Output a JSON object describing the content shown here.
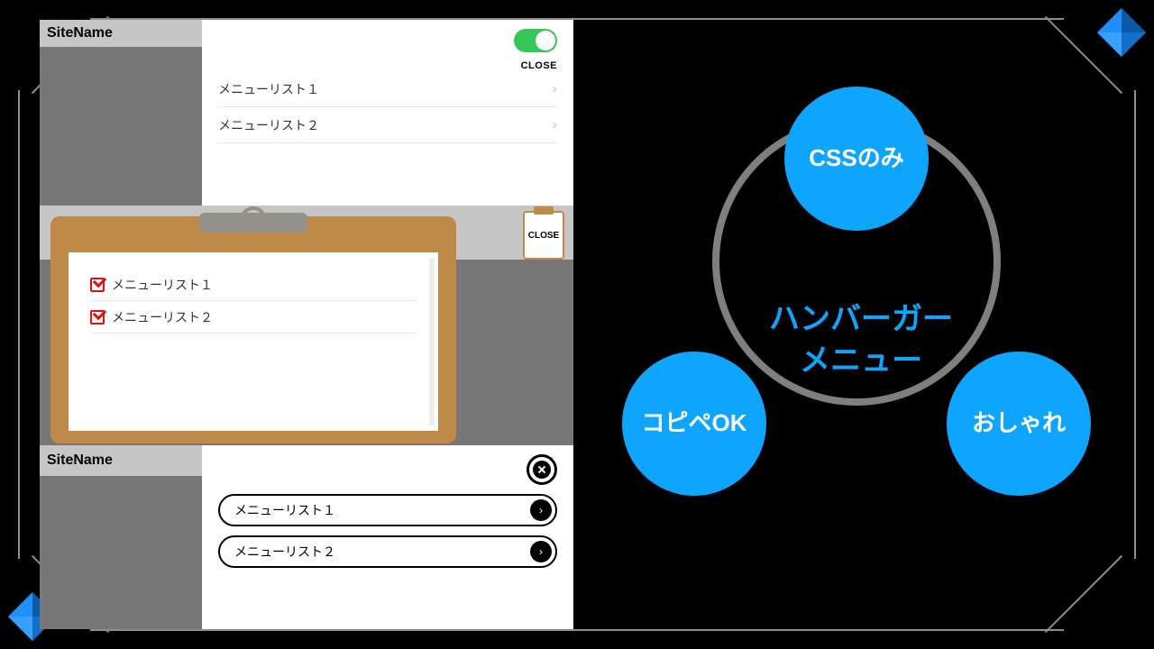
{
  "panel1": {
    "site_name": "SiteName",
    "close_label": "CLOSE",
    "items": [
      "メニューリスト１",
      "メニューリスト２"
    ]
  },
  "panel2": {
    "close_label": "CLOSE",
    "items": [
      "メニューリスト１",
      "メニューリスト２"
    ]
  },
  "panel3": {
    "site_name": "SiteName",
    "items": [
      "メニューリスト１",
      "メニューリスト２"
    ]
  },
  "infographic": {
    "top": "CSSのみ",
    "bottom_left": "コピペOK",
    "bottom_right": "おしゃれ",
    "center_line1": "ハンバーガー",
    "center_line2": "メニュー"
  },
  "colors": {
    "accent": "#0ea5ff",
    "toggle_on": "#34c759",
    "clipboard": "#bf8a47"
  }
}
